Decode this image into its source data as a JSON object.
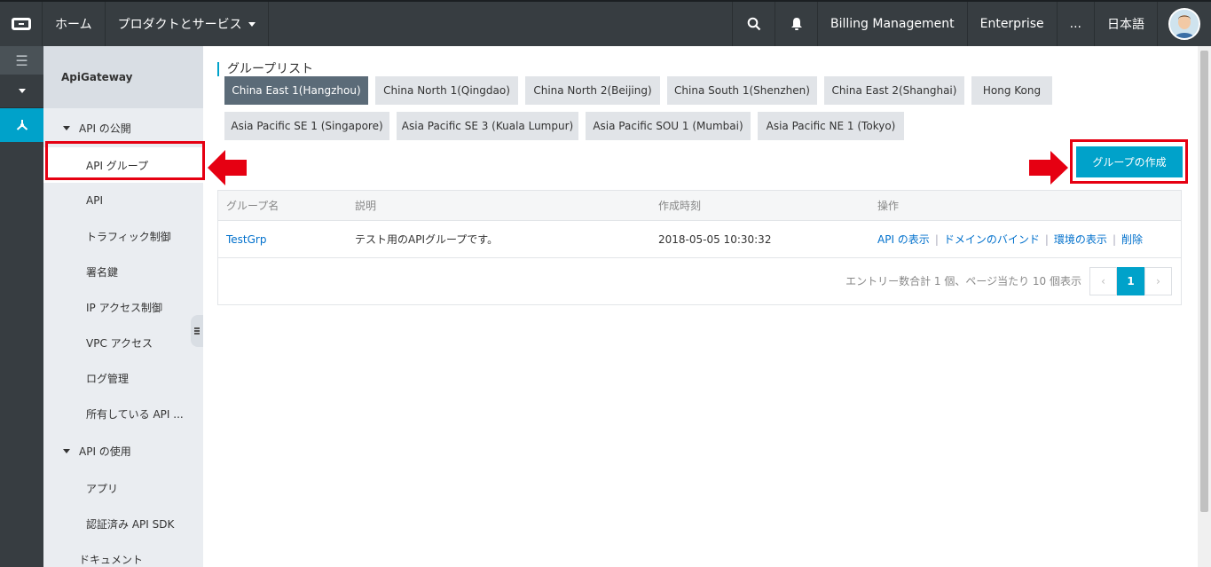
{
  "topbar": {
    "home": "ホーム",
    "products": "プロダクトとサービス",
    "billing": "Billing Management",
    "enterprise": "Enterprise",
    "more": "...",
    "language": "日本語"
  },
  "submenu": {
    "title": "ApiGateway",
    "publish_section": "API の公開",
    "publish_items": [
      "API グループ",
      "API",
      "トラフィック制御",
      "署名鍵",
      "IP アクセス制御",
      "VPC アクセス",
      "ログ管理",
      "所有している API ..."
    ],
    "use_section": "API の使用",
    "use_items": [
      "アプリ",
      "認証済み API SDK"
    ],
    "documents": "ドキュメント"
  },
  "main": {
    "title": "グループリスト",
    "regions_row1": [
      "China East 1(Hangzhou)",
      "China North 1(Qingdao)",
      "China North 2(Beijing)",
      "China South 1(Shenzhen)",
      "China East 2(Shanghai)",
      "Hong Kong"
    ],
    "regions_row2": [
      "Asia Pacific SE 1 (Singapore)",
      "Asia Pacific SE 3 (Kuala Lumpur)",
      "Asia Pacific SOU 1 (Mumbai)",
      "Asia Pacific NE 1 (Tokyo)"
    ],
    "create_button": "グループの作成",
    "table": {
      "headers": [
        "グループ名",
        "説明",
        "作成時刻",
        "操作"
      ],
      "rows": [
        {
          "name": "TestGrp",
          "description": "テスト用のAPIグループです。",
          "created": "2018-05-05 10:30:32",
          "actions": [
            "API の表示",
            "ドメインのバインド",
            "環境の表示",
            "削除"
          ]
        }
      ]
    },
    "pager": {
      "info": "エントリー数合計 1 個、ページ当たり 10 個表示",
      "prev": "‹",
      "current": "1",
      "next": "›"
    }
  },
  "colors": {
    "accent": "#00a2ca",
    "highlight_red": "#e60012",
    "active_region": "#5b6b78"
  }
}
